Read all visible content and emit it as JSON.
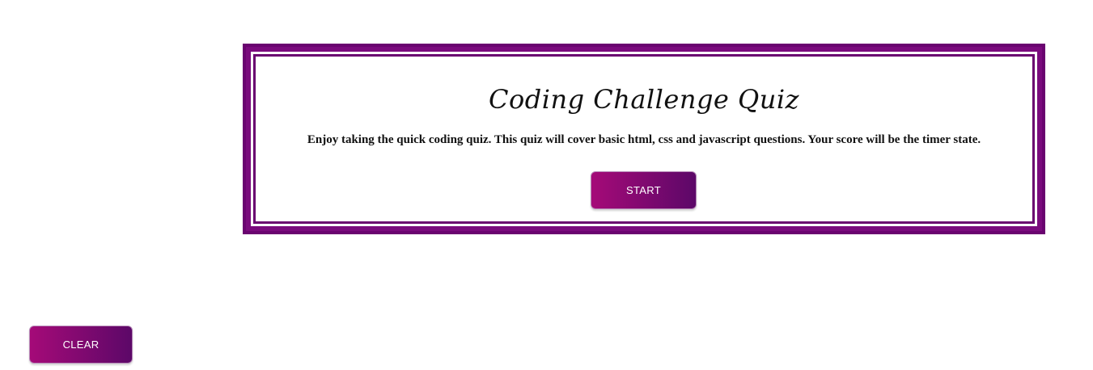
{
  "quiz": {
    "title": "Coding Challenge Quiz",
    "description": "Enjoy taking the quick coding quiz. This quiz will cover basic html, css and javascript questions. Your score will be the timer state.",
    "start_label": "START"
  },
  "footer": {
    "clear_label": "CLEAR"
  },
  "colors": {
    "border": "#7a0a7d",
    "button_gradient_start": "#a50a78",
    "button_gradient_end": "#5c0868",
    "button_text": "#ffffff"
  }
}
